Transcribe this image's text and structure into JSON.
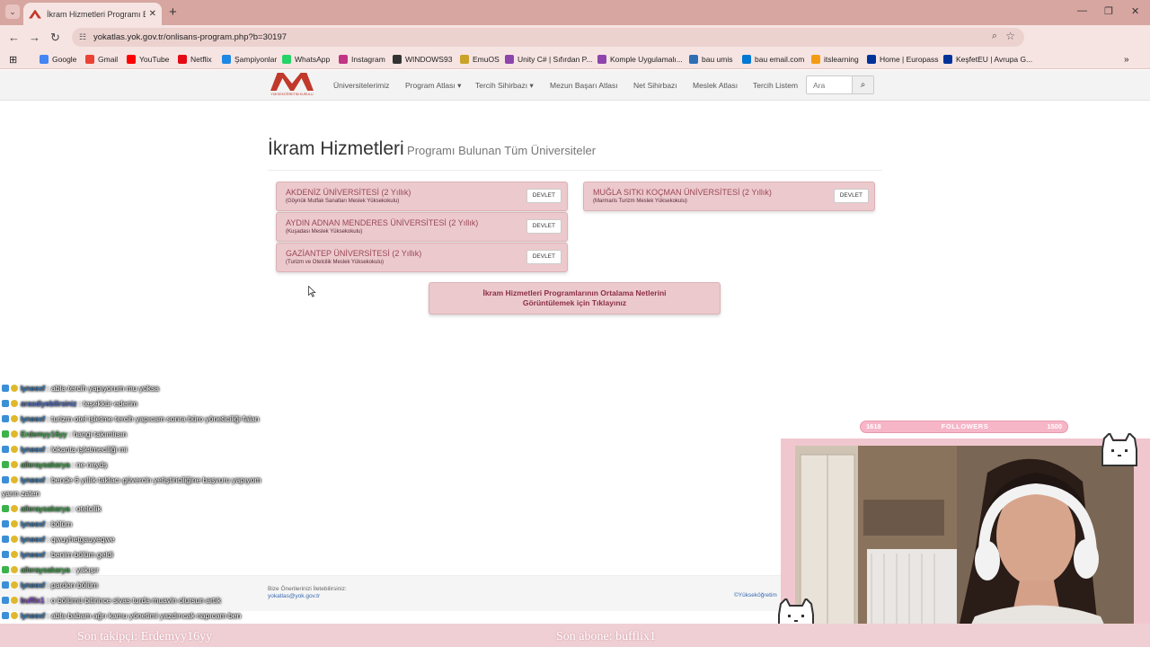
{
  "browser": {
    "tab_title": "İkram Hizmetleri Programı Bulu",
    "url": "yokatlas.yok.gov.tr/onlisans-program.php?b=30197",
    "bookmarks": [
      {
        "label": "Google",
        "color": "#4285f4"
      },
      {
        "label": "Gmail",
        "color": "#ea4335"
      },
      {
        "label": "YouTube",
        "color": "#ff0000"
      },
      {
        "label": "Netflix",
        "color": "#e50914"
      },
      {
        "label": "Şampiyonlar",
        "color": "#1e88e5"
      },
      {
        "label": "WhatsApp",
        "color": "#25d366"
      },
      {
        "label": "Instagram",
        "color": "#c13584"
      },
      {
        "label": "WINDOWS93",
        "color": "#333333"
      },
      {
        "label": "EmuOS",
        "color": "#c9a227"
      },
      {
        "label": "Unity C# | Sıfırdan P...",
        "color": "#8e44ad"
      },
      {
        "label": "Komple Uygulamalı...",
        "color": "#8e44ad"
      },
      {
        "label": "bau umis",
        "color": "#2c6fb7"
      },
      {
        "label": "bau email.com",
        "color": "#0078d4"
      },
      {
        "label": "itslearning",
        "color": "#f39c12"
      },
      {
        "label": "Home | Europass",
        "color": "#003399"
      },
      {
        "label": "KeşfetEU | Avrupa G...",
        "color": "#003399"
      }
    ]
  },
  "site": {
    "logo_text": "YÜKSEKÖĞRETİM KURULU",
    "menu": [
      "Üniversitelerimiz",
      "Program Atlası ▾",
      "Tercih Sihirbazı ▾",
      "Mezun Başarı Atlası",
      "Net Sihirbazı",
      "Meslek Atlası",
      "Tercih Listem"
    ],
    "search_placeholder": "Ara"
  },
  "page": {
    "title": "İkram Hizmetleri",
    "subtitle": "Programı Bulunan Tüm Üniversiteler",
    "universities_left": [
      {
        "name": "AKDENİZ ÜNİVERSİTESİ (2 Yıllık)",
        "school": "(Göynük Mutfak Sanatları Meslek Yüksekokulu)",
        "type": "DEVLET"
      },
      {
        "name": "AYDIN ADNAN MENDERES ÜNİVERSİTESİ (2 Yıllık)",
        "school": "(Kuşadası Meslek Yüksekokulu)",
        "type": "DEVLET"
      },
      {
        "name": "GAZİANTEP ÜNİVERSİTESİ (2 Yıllık)",
        "school": "(Turizm ve Otelcilik Meslek Yüksekokulu)",
        "type": "DEVLET"
      }
    ],
    "universities_right": [
      {
        "name": "MUĞLA SITKI KOÇMAN ÜNİVERSİTESİ (2 Yıllık)",
        "school": "(Marmaris Turizm Meslek Yüksekokulu)",
        "type": "DEVLET"
      }
    ],
    "avg_button_line1": "İkram Hizmetleri Programlarının Ortalama Netlerini",
    "avg_button_line2": "Görüntülemek için Tıklayınız",
    "footer_line1": "Bize Önerilerinizi İletebilirsiniz:",
    "footer_email": "yokatlas@yok.gov.tr",
    "footer_right": "©Yükseköğretim"
  },
  "stream": {
    "chat": [
      {
        "user": "lyneexf",
        "ucolor": "#1e7fd6",
        "text": " : abla tercih yapıyorum mu yoksa"
      },
      {
        "user": "arasdiyebilirsiniz",
        "ucolor": "#4d6fd1",
        "text": " : teşekkür ederim"
      },
      {
        "user": "lyneexf",
        "ucolor": "#1e7fd6",
        "text": " : turizm otel işletme tercih yapıcam sonra büro yöneticiliği falan"
      },
      {
        "user": "Erdemyy16yy",
        "ucolor": "#3bb34a",
        "text": " : hangi takımlısın"
      },
      {
        "user": "lyneexf",
        "ucolor": "#1e7fd6",
        "text": " : lokanta işletmeciliği mi"
      },
      {
        "user": "alleraysakarya",
        "ucolor": "#3bb34a",
        "text": " : ne neydş"
      },
      {
        "user": "lyneexf",
        "ucolor": "#1e7fd6",
        "text": " : bende 6 yıllık taklacı güvercin yetiştiriciliğine başvuru yapıyom"
      },
      {
        "user": "",
        "ucolor": "#ffffff",
        "text": "yarın zaten"
      },
      {
        "user": "alleraysakarya",
        "ucolor": "#3bb34a",
        "text": " : otelcilik"
      },
      {
        "user": "lyneexf",
        "ucolor": "#1e7fd6",
        "text": " : bölüm"
      },
      {
        "user": "lyneexf",
        "ucolor": "#1e7fd6",
        "text": " : qwuyhetgauyeqwe"
      },
      {
        "user": "lyneexf",
        "ucolor": "#1e7fd6",
        "text": " : benim bölüm geldi"
      },
      {
        "user": "alleraysakarya",
        "ucolor": "#3bb34a",
        "text": " : yakışır"
      },
      {
        "user": "lyneexf",
        "ucolor": "#1e7fd6",
        "text": " : pardon bölüm"
      },
      {
        "user": "bufflix1",
        "ucolor": "#8a4fd8",
        "text": " : o bölümü bitirince sivas turda muavin olursun artık"
      },
      {
        "user": "lyneexf",
        "ucolor": "#1e7fd6",
        "text": " : abla babam ağrı kamu yönetimi yazdırıcak napıcam ben"
      }
    ],
    "followers_current": "1618",
    "followers_label": "FOLLOWERS",
    "followers_goal": "1500",
    "last_follower": "Son takipçi: Erdemyy16yy",
    "last_sub": "Son abone: bufflix1"
  }
}
